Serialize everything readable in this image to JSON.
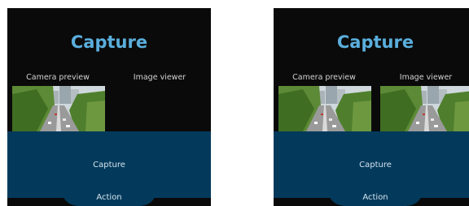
{
  "screens": [
    {
      "title": "Capture",
      "camera_label": "Camera preview",
      "viewer_label": "Image viewer",
      "viewer_has_image": false,
      "capture_label": "Capture",
      "action_label": "Action"
    },
    {
      "title": "Capture",
      "camera_label": "Camera preview",
      "viewer_label": "Image viewer",
      "viewer_has_image": true,
      "capture_label": "Capture",
      "action_label": "Action"
    }
  ],
  "colors": {
    "title": "#5aaedc",
    "panel": "#033a5c",
    "screen_bg": "#0a0a0a"
  }
}
